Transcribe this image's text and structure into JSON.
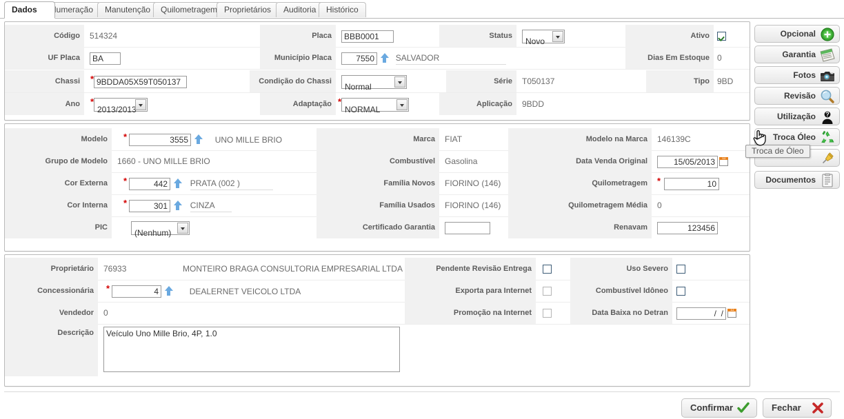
{
  "tabs": [
    {
      "label": "Dados",
      "active": true
    },
    {
      "label": "Numeração",
      "active": false
    },
    {
      "label": "Manutenção",
      "active": false
    },
    {
      "label": "Quilometragem",
      "active": false
    },
    {
      "label": "Proprietários",
      "active": false
    },
    {
      "label": "Auditoria",
      "active": false
    },
    {
      "label": "Histórico",
      "active": false
    }
  ],
  "panel1": {
    "codigo_label": "Código",
    "codigo_value": "514324",
    "placa_label": "Placa",
    "placa_value": "BBB0001",
    "status_label": "Status",
    "status_value": "Novo",
    "ativo_label": "Ativo",
    "ativo_checked": true,
    "uf_placa_label": "UF Placa",
    "uf_placa_value": "BA",
    "municipio_label": "Município Placa",
    "municipio_value": "7550",
    "municipio_desc": "SALVADOR",
    "dias_label": "Dias Em Estoque",
    "dias_value": "0",
    "chassi_label": "Chassi",
    "chassi_value": "9BDDA05X59T050137",
    "cond_chassi_label": "Condição do Chassi",
    "cond_chassi_value": "Normal",
    "serie_label": "Série",
    "serie_value": "T050137",
    "tipo_label": "Tipo",
    "tipo_value": "9BD",
    "ano_label": "Ano",
    "ano_value": "2013/2013",
    "adaptacao_label": "Adaptação",
    "adaptacao_value": "NORMAL",
    "aplicacao_label": "Aplicação",
    "aplicacao_value": "9BDD"
  },
  "panel2": {
    "modelo_label": "Modelo",
    "modelo_value": "3555",
    "modelo_desc": "UNO MILLE BRIO",
    "marca_label": "Marca",
    "marca_value": "FIAT",
    "modelo_marca_label": "Modelo na Marca",
    "modelo_marca_value": "146139C",
    "grupo_label": "Grupo de Modelo",
    "grupo_value": "1660 - UNO MILLE BRIO",
    "combustivel_label": "Combustível",
    "combustivel_value": "Gasolina",
    "data_venda_label": "Data Venda Original",
    "data_venda_value": "15/05/2013",
    "cor_externa_label": "Cor Externa",
    "cor_externa_value": "442",
    "cor_externa_desc": "PRATA (002 )",
    "familia_novos_label": "Família Novos",
    "familia_novos_value": "FIORINO (146)",
    "quilometragem_label": "Quilometragem",
    "quilometragem_value": "10",
    "cor_interna_label": "Cor Interna",
    "cor_interna_value": "301",
    "cor_interna_desc": "CINZA",
    "familia_usados_label": "Família Usados",
    "familia_usados_value": "FIORINO (146)",
    "km_media_label": "Quilometragem Média",
    "km_media_value": "0",
    "pic_label": "PIC",
    "pic_value": "(Nenhum)",
    "certificado_label": "Certificado Garantia",
    "certificado_value": "",
    "renavam_label": "Renavam",
    "renavam_value": "123456"
  },
  "panel3": {
    "proprietario_label": "Proprietário",
    "proprietario_value": "76933",
    "proprietario_desc": "MONTEIRO BRAGA CONSULTORIA EMPRESARIAL LTDA",
    "concessionaria_label": "Concessionária",
    "concessionaria_value": "4",
    "concessionaria_desc": "DEALERNET VEICOLO LTDA",
    "vendedor_label": "Vendedor",
    "vendedor_value": "0",
    "descricao_label": "Descrição",
    "descricao_value": "Veículo Uno Mille Brio, 4P, 1.0",
    "pendente_label": "Pendente Revisão Entrega",
    "pendente_checked": false,
    "uso_severo_label": "Uso Severo",
    "uso_severo_checked": false,
    "exporta_label": "Exporta para Internet",
    "exporta_checked": false,
    "comb_idoneo_label": "Combustível Idôneo",
    "comb_idoneo_checked": false,
    "promocao_label": "Promoção na Internet",
    "promocao_checked": false,
    "data_baixa_label": "Data Baixa no Detran",
    "data_baixa_value": "  /  /"
  },
  "sidebar": {
    "items": [
      {
        "label": "Opcional",
        "icon": "plus-circle-icon"
      },
      {
        "label": "Garantia",
        "icon": "certificate-icon"
      },
      {
        "label": "Fotos",
        "icon": "camera-icon"
      },
      {
        "label": "Revisão",
        "icon": "magnifier-icon"
      },
      {
        "label": "Utilização",
        "icon": "person-question-icon"
      },
      {
        "label": "Troca Óleo",
        "icon": "recycle-icon"
      },
      {
        "label": "",
        "icon": "pushpin-icon"
      },
      {
        "label": "Documentos",
        "icon": "document-list-icon"
      }
    ]
  },
  "tooltip": {
    "text": "Troca de Óleo"
  },
  "footer": {
    "confirmar_label": "Confirmar",
    "fechar_label": "Fechar"
  },
  "colors": {
    "required_marker": "#d40000",
    "label_bg": "#f1f1f1",
    "accent_blue": "#6aa9e0",
    "check_green": "#2b7a2b",
    "close_red": "#c62828"
  }
}
